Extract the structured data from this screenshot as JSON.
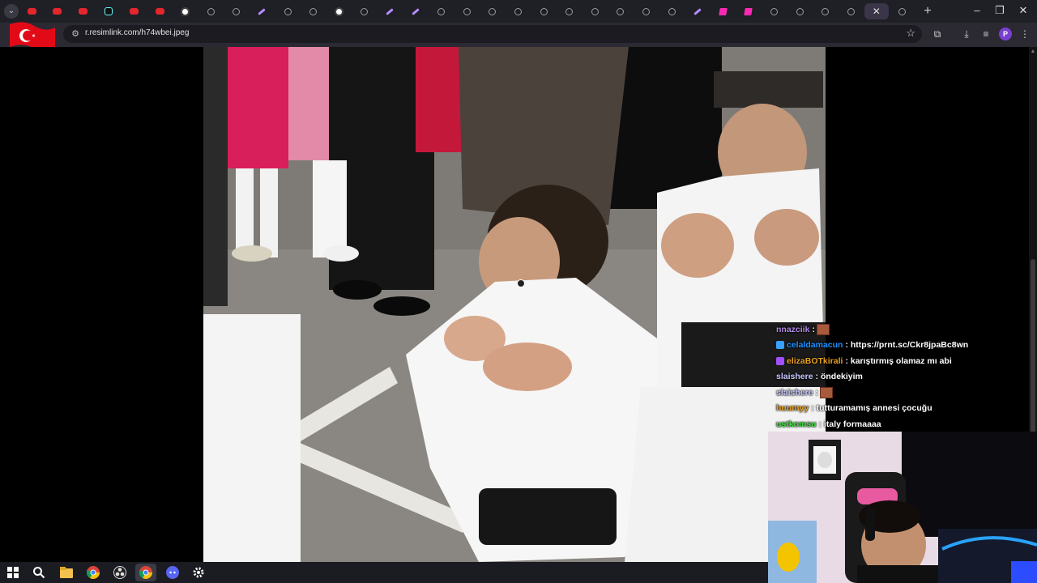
{
  "browser": {
    "tabs": [
      {
        "icon": "youtube-icon",
        "type": "yt"
      },
      {
        "icon": "youtube-icon",
        "type": "yt"
      },
      {
        "icon": "youtube-icon",
        "type": "yt"
      },
      {
        "icon": "tiktok-icon",
        "type": "tk"
      },
      {
        "icon": "youtube-icon",
        "type": "yt"
      },
      {
        "icon": "youtube-icon",
        "type": "yt"
      },
      {
        "icon": "google-icon",
        "type": "gg"
      },
      {
        "icon": "globe-icon",
        "type": "globe"
      },
      {
        "icon": "globe-icon",
        "type": "globe"
      },
      {
        "icon": "feather-icon",
        "type": "feather"
      },
      {
        "icon": "globe-icon",
        "type": "globe"
      },
      {
        "icon": "globe-icon",
        "type": "globe"
      },
      {
        "icon": "google-icon",
        "type": "gg"
      },
      {
        "icon": "globe-icon",
        "type": "globe"
      },
      {
        "icon": "feather-icon",
        "type": "feather"
      },
      {
        "icon": "feather-icon",
        "type": "feather"
      },
      {
        "icon": "globe-icon",
        "type": "globe"
      },
      {
        "icon": "globe-icon",
        "type": "globe"
      },
      {
        "icon": "globe-icon",
        "type": "globe"
      },
      {
        "icon": "globe-icon",
        "type": "globe"
      },
      {
        "icon": "globe-icon",
        "type": "globe"
      },
      {
        "icon": "globe-icon",
        "type": "globe"
      },
      {
        "icon": "globe-icon",
        "type": "globe"
      },
      {
        "icon": "globe-icon",
        "type": "globe"
      },
      {
        "icon": "globe-icon",
        "type": "globe"
      },
      {
        "icon": "globe-icon",
        "type": "globe"
      },
      {
        "icon": "feather-icon",
        "type": "feather"
      },
      {
        "icon": "pink-app-icon",
        "type": "pink"
      },
      {
        "icon": "pink-app-icon",
        "type": "pink"
      },
      {
        "icon": "globe-icon",
        "type": "globe"
      },
      {
        "icon": "globe-icon",
        "type": "globe"
      },
      {
        "icon": "globe-icon",
        "type": "globe"
      },
      {
        "icon": "globe-icon",
        "type": "globe"
      },
      {
        "icon": "close-icon",
        "type": "active"
      },
      {
        "icon": "globe-icon",
        "type": "globe"
      }
    ],
    "new_tab_label": "+",
    "window_controls": {
      "minimize": "–",
      "maximize": "❐",
      "close": "✕"
    },
    "address": {
      "url": "r.resimlink.com/h74wbei.jpeg"
    },
    "profile_initial": "P"
  },
  "chat": {
    "messages": [
      {
        "user": "nnazciik",
        "color": "#b48ae8",
        "text": "",
        "emote": true,
        "badge": ""
      },
      {
        "user": "celaldamacun",
        "color": "#1e90ff",
        "text": ": https://prnt.sc/Ckr8jpaBc8wn",
        "emote": false,
        "badge": "#3aa0ff"
      },
      {
        "user": "elizaBOTkirali",
        "color": "#e8a020",
        "text": ": karıştırmış olamaz mı abi",
        "emote": false,
        "badge": "#a050ff"
      },
      {
        "user": "slaishere",
        "color": "#c8c8ff",
        "text": ": öndekiyim",
        "emote": false,
        "badge": ""
      },
      {
        "user": "slaishere",
        "color": "#c8c8ff",
        "text": "",
        "emote": true,
        "badge": ""
      },
      {
        "user": "huumyy",
        "color": "#e8a020",
        "text": ": tutturamamış annesi çocuğu",
        "emote": false,
        "badge": ""
      },
      {
        "user": "ustkomsu",
        "color": "#3ee03e",
        "text": ": italy formaaaa",
        "emote": false,
        "badge": ""
      }
    ]
  },
  "taskbar": {
    "items": [
      {
        "name": "windows-start-icon",
        "active": false
      },
      {
        "name": "search-icon",
        "active": false
      },
      {
        "name": "file-explorer-icon",
        "active": false
      },
      {
        "name": "chrome-icon",
        "active": false
      },
      {
        "name": "obs-icon",
        "active": false
      },
      {
        "name": "chrome-icon",
        "active": true
      },
      {
        "name": "discord-icon",
        "active": false
      },
      {
        "name": "settings-gear-icon",
        "active": false
      }
    ]
  },
  "colors": {
    "chrome_frame": "#1f1f26",
    "toolbar": "#2b2a33",
    "taskbar": "#1b1b22"
  }
}
